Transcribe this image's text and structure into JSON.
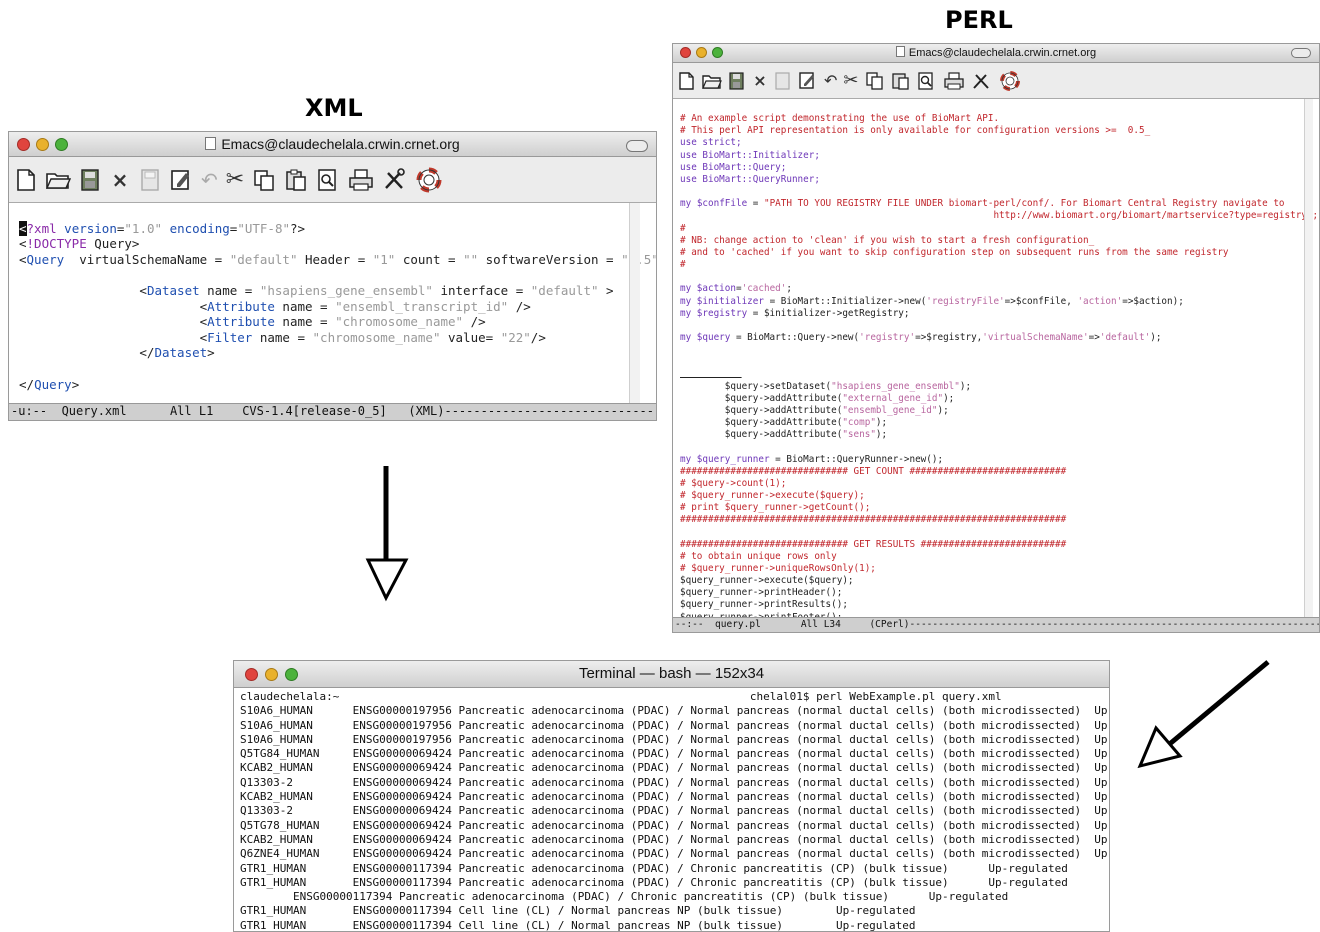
{
  "labels": {
    "xml": "XML",
    "perl": "PERL"
  },
  "colors": {
    "xml_tag": "#1f4fb0",
    "perl_comment": "#c1272d",
    "perl_keyword": "#6e37b8",
    "perl_string": "#b8659f"
  },
  "icons": [
    "new-file-icon",
    "open-folder-icon",
    "save-disk-icon",
    "close-x-icon",
    "save-gray-icon",
    "save-as-icon",
    "undo-icon",
    "cut-scissors-icon",
    "copy-icon",
    "paste-icon",
    "find-icon",
    "print-icon",
    "tools-icon",
    "help-lifebuoy-icon"
  ],
  "xml_window": {
    "title": "Emacs@claudechelala.crwin.crnet.org",
    "modeline": "-u:--  Query.xml      All L1    CVS-1.4[release-0_5]   (XML)---------------------------------------------------"
  },
  "perl_window": {
    "title": "Emacs@claudechelala.crwin.crnet.org",
    "modeline": "--:--  query.pl       All L34     (CPerl)-----------------------------------------------------------------------------------------------------"
  },
  "terminal": {
    "title": "Terminal — bash — 152x34",
    "lines": [
      "claudechelala:~                                                              chelal01$ perl WebExample.pl query.xml",
      "S10A6_HUMAN      ENSG00000197956 Pancreatic adenocarcinoma (PDAC) / Normal pancreas (normal ductal cells) (both microdissected)  Up-regulated",
      "S10A6_HUMAN      ENSG00000197956 Pancreatic adenocarcinoma (PDAC) / Normal pancreas (normal ductal cells) (both microdissected)  Up-regulated",
      "S10A6_HUMAN      ENSG00000197956 Pancreatic adenocarcinoma (PDAC) / Normal pancreas (normal ductal cells) (both microdissected)  Up-regulated",
      "Q5TG84_HUMAN     ENSG00000069424 Pancreatic adenocarcinoma (PDAC) / Normal pancreas (normal ductal cells) (both microdissected)  Up-regulated",
      "KCAB2_HUMAN      ENSG00000069424 Pancreatic adenocarcinoma (PDAC) / Normal pancreas (normal ductal cells) (both microdissected)  Up-regulated",
      "Q13303-2         ENSG00000069424 Pancreatic adenocarcinoma (PDAC) / Normal pancreas (normal ductal cells) (both microdissected)  Up-regulated",
      "KCAB2_HUMAN      ENSG00000069424 Pancreatic adenocarcinoma (PDAC) / Normal pancreas (normal ductal cells) (both microdissected)  Up-regulated",
      "Q13303-2         ENSG00000069424 Pancreatic adenocarcinoma (PDAC) / Normal pancreas (normal ductal cells) (both microdissected)  Up-regulated",
      "Q5TG78_HUMAN     ENSG00000069424 Pancreatic adenocarcinoma (PDAC) / Normal pancreas (normal ductal cells) (both microdissected)  Up-regulated",
      "KCAB2_HUMAN      ENSG00000069424 Pancreatic adenocarcinoma (PDAC) / Normal pancreas (normal ductal cells) (both microdissected)  Up-regulated",
      "Q6ZNE4_HUMAN     ENSG00000069424 Pancreatic adenocarcinoma (PDAC) / Normal pancreas (normal ductal cells) (both microdissected)  Up-regulated",
      "GTR1_HUMAN       ENSG00000117394 Pancreatic adenocarcinoma (PDAC) / Chronic pancreatitis (CP) (bulk tissue)      Up-regulated",
      "GTR1_HUMAN       ENSG00000117394 Pancreatic adenocarcinoma (PDAC) / Chronic pancreatitis (CP) (bulk tissue)      Up-regulated",
      "        ENSG00000117394 Pancreatic adenocarcinoma (PDAC) / Chronic pancreatitis (CP) (bulk tissue)      Up-regulated",
      "GTR1_HUMAN       ENSG00000117394 Cell line (CL) / Normal pancreas NP (bulk tissue)        Up-regulated",
      "GTR1_HUMAN       ENSG00000117394 Cell line (CL) / Normal pancreas NP (bulk tissue)        Up-regulated"
    ]
  }
}
